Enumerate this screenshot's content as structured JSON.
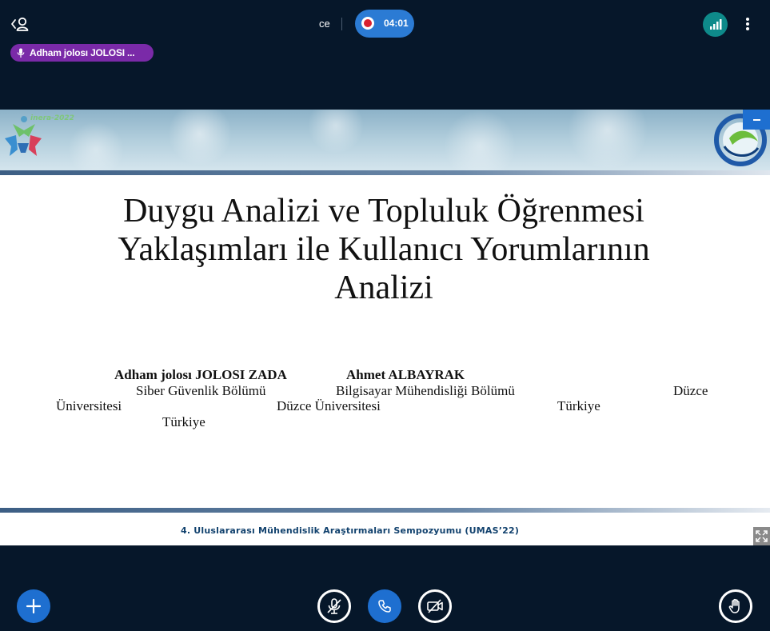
{
  "topbar": {
    "meeting_name": "ce",
    "recording_time": "04:01"
  },
  "talker": {
    "name": "Adham jolosı JOLOSI ..."
  },
  "slide": {
    "header_logo_text": "inera-2022",
    "title_lines": [
      "Duygu Analizi ve Topluluk Öğrenmesi",
      "Yaklaşımları ile Kullanıcı Yorumlarının",
      "Analizi"
    ],
    "authors": {
      "author1_name": "Adham jolosı JOLOSI ZADA",
      "author2_name": "Ahmet ALBAYRAK",
      "author1_dept": "Siber Güvenlik Bölümü",
      "author2_dept": "Bilgisayar Mühendisliği Bölümü",
      "duzce_word": "Düzce",
      "universitesi_word": "Üniversitesi",
      "duzce_university": "Düzce Üniversitesi",
      "country_right": "Türkiye",
      "country_left": "Türkiye"
    },
    "footer_text": "4. Uluslararası Mühendislik Araştırmaları Sempozyumu (UMAS’22)"
  },
  "icons": {
    "users": "users-icon",
    "record": "record-icon",
    "connection": "connection-status-icon",
    "more": "more-vertical-icon",
    "mic_talker": "microphone-icon",
    "actions": "plus-icon",
    "mic": "mic-muted-icon",
    "phone": "phone-icon",
    "camera": "camera-off-icon",
    "hand": "raise-hand-icon",
    "fullscreen": "fullscreen-icon",
    "minimize": "minimize-icon"
  },
  "colors": {
    "background": "#06172a",
    "accent_blue": "#1e6fd0",
    "talker_purple": "#7a2aa8",
    "connection_teal": "#0e8a8a",
    "record_red": "#d9202f"
  }
}
